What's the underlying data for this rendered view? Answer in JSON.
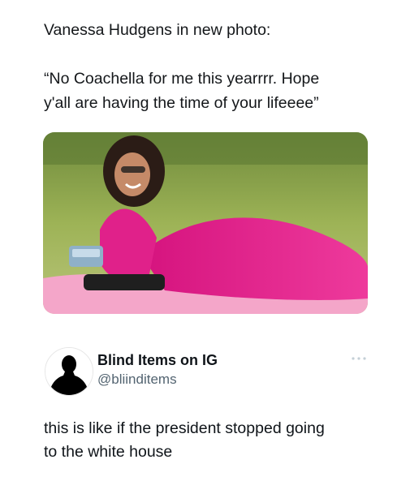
{
  "quoted_post": {
    "line1": "Vanessa Hudgens in new photo:",
    "line2": "“No Coachella for me this yearrrr. Hope",
    "line3": "y'all are having the time of your lifeeee”"
  },
  "image": {
    "description_icon": "photo-of-woman-in-pink-dress-lying-on-grass"
  },
  "author": {
    "display_name": "Blind Items on IG",
    "handle": "@bliinditems",
    "avatar_icon": "silhouette-avatar-icon"
  },
  "tweet": {
    "line1": "this is like if the president stopped going",
    "line2": "to the white house"
  },
  "colors": {
    "text": "#0f1419",
    "secondary_text": "#536471",
    "dress": "#e0218a",
    "grass": "#8fa84a"
  }
}
